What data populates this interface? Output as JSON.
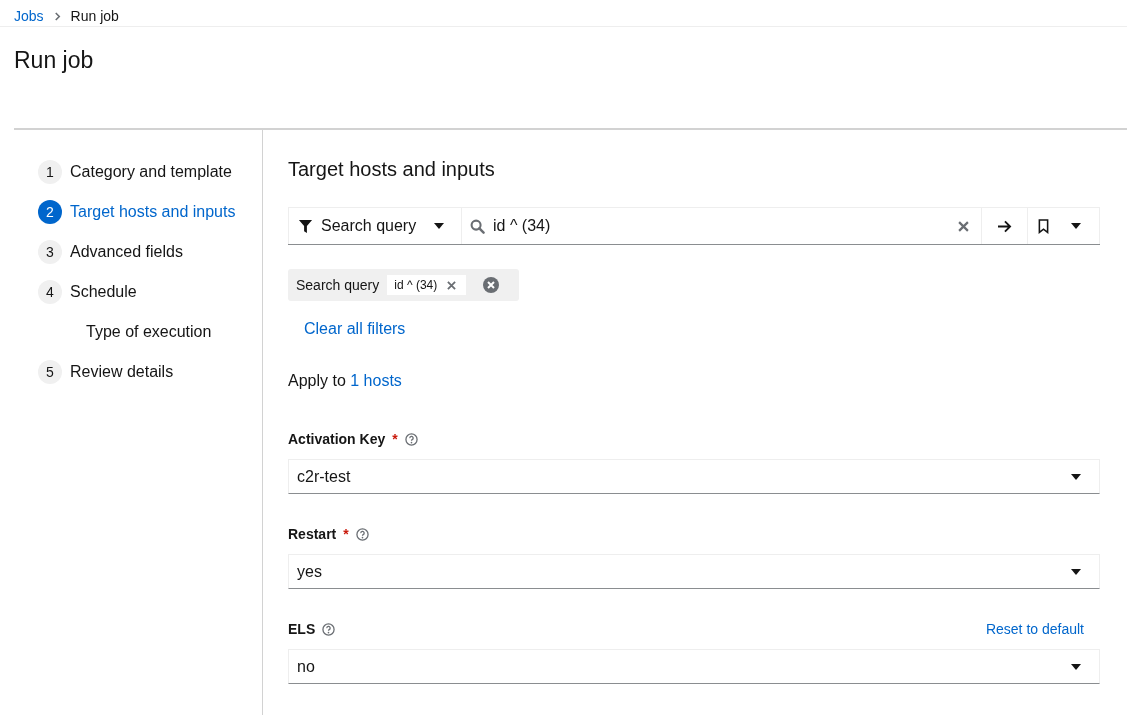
{
  "breadcrumb": [
    {
      "label": "Jobs",
      "link": true
    },
    {
      "label": "Run job",
      "link": false
    }
  ],
  "title": "Run job",
  "steps": [
    {
      "number": "1",
      "label": "Category and template",
      "selected": false
    },
    {
      "number": "2",
      "label": "Target hosts and inputs",
      "selected": true
    },
    {
      "number": "3",
      "label": "Advanced fields",
      "selected": false
    },
    {
      "number": "4",
      "label": "Schedule",
      "selected": false,
      "children": [
        {
          "label": "Type of execution",
          "selected": false
        }
      ]
    },
    {
      "number": "5",
      "label": "Review details",
      "selected": false
    }
  ],
  "section_title": "Target hosts and inputs",
  "search": {
    "filter": "Search query",
    "value": "id ^ (34)"
  },
  "chip_group": {
    "category": "Search query",
    "chips": [
      "id ^ (34)"
    ]
  },
  "clear_filters": "Clear all filters",
  "apply_to": {
    "text": "Apply to ",
    "link": "1 hosts"
  },
  "required_marker": "*",
  "fields": [
    {
      "label": "Activation Key",
      "required": true,
      "value": "c2r-test"
    },
    {
      "label": "Restart",
      "required": true,
      "value": "yes"
    },
    {
      "label": "ELS",
      "required": false,
      "value": "no",
      "reset": "Reset to default"
    }
  ]
}
